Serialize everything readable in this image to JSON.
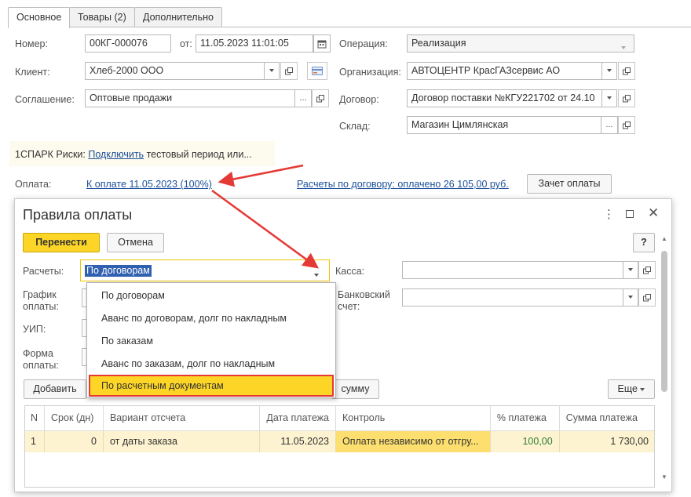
{
  "tabs": [
    {
      "label": "Основное"
    },
    {
      "label": "Товары (2)"
    },
    {
      "label": "Дополнительно"
    }
  ],
  "form": {
    "number_label": "Номер:",
    "number_value": "00КГ-000076",
    "from_label": "от:",
    "date_value": "11.05.2023 11:01:05",
    "operation_label": "Операция:",
    "operation_value": "Реализация",
    "client_label": "Клиент:",
    "client_value": "Хлеб-2000 ООО",
    "organization_label": "Организация:",
    "organization_value": "АВТОЦЕНТР КрасГАЗсервис АО",
    "agreement_label": "Соглашение:",
    "agreement_value": "Оптовые продажи",
    "contract_label": "Договор:",
    "contract_value": "Договор поставки №КГУ221702 от 24.10",
    "warehouse_label": "Склад:",
    "warehouse_value": "Магазин Цимлянская"
  },
  "banner": {
    "prefix": "1СПАРК Риски:",
    "link": "Подключить",
    "suffix": "тестовый период или..."
  },
  "payment": {
    "label": "Оплата:",
    "link_due": "К оплате 11.05.2023 (100%)",
    "link_settlements": "Расчеты по договору: оплачено 26 105,00 руб.",
    "offset_button": "Зачет оплаты"
  },
  "dialog": {
    "title": "Правила оплаты",
    "transfer_button": "Перенести",
    "cancel_button": "Отмена",
    "help_button": "?",
    "settlements_label": "Расчеты:",
    "settlements_value": "По договорам",
    "cash_label": "Касса:",
    "schedule_label_1": "График",
    "schedule_label_2": "оплаты:",
    "bank_label_1": "Банковский",
    "bank_label_2": "счет:",
    "uip_label": "УИП:",
    "form_label_1": "Форма",
    "form_label_2": "оплаты:",
    "add_button": "Добавить",
    "sum_button": "сумму",
    "more_button": "Еще",
    "dropdown_options": [
      "По договорам",
      "Аванс по договорам, долг по накладным",
      "По заказам",
      "Аванс по заказам, долг по накладным",
      "По расчетным документам"
    ],
    "table": {
      "headers": [
        "N",
        "Срок (дн)",
        "Вариант отсчета",
        "Дата платежа",
        "Контроль",
        "% платежа",
        "Сумма платежа"
      ],
      "rows": [
        [
          "1",
          "0",
          "от даты заказа",
          "11.05.2023",
          "Оплата независимо от отгру...",
          "100,00",
          "1 730,00"
        ]
      ]
    }
  },
  "colors": {
    "accent_yellow": "#fcd526",
    "link_blue": "#1a4f9a",
    "highlight_border": "#e53935",
    "row_highlight": "#fdf3d0",
    "arrow": "#e53935"
  }
}
